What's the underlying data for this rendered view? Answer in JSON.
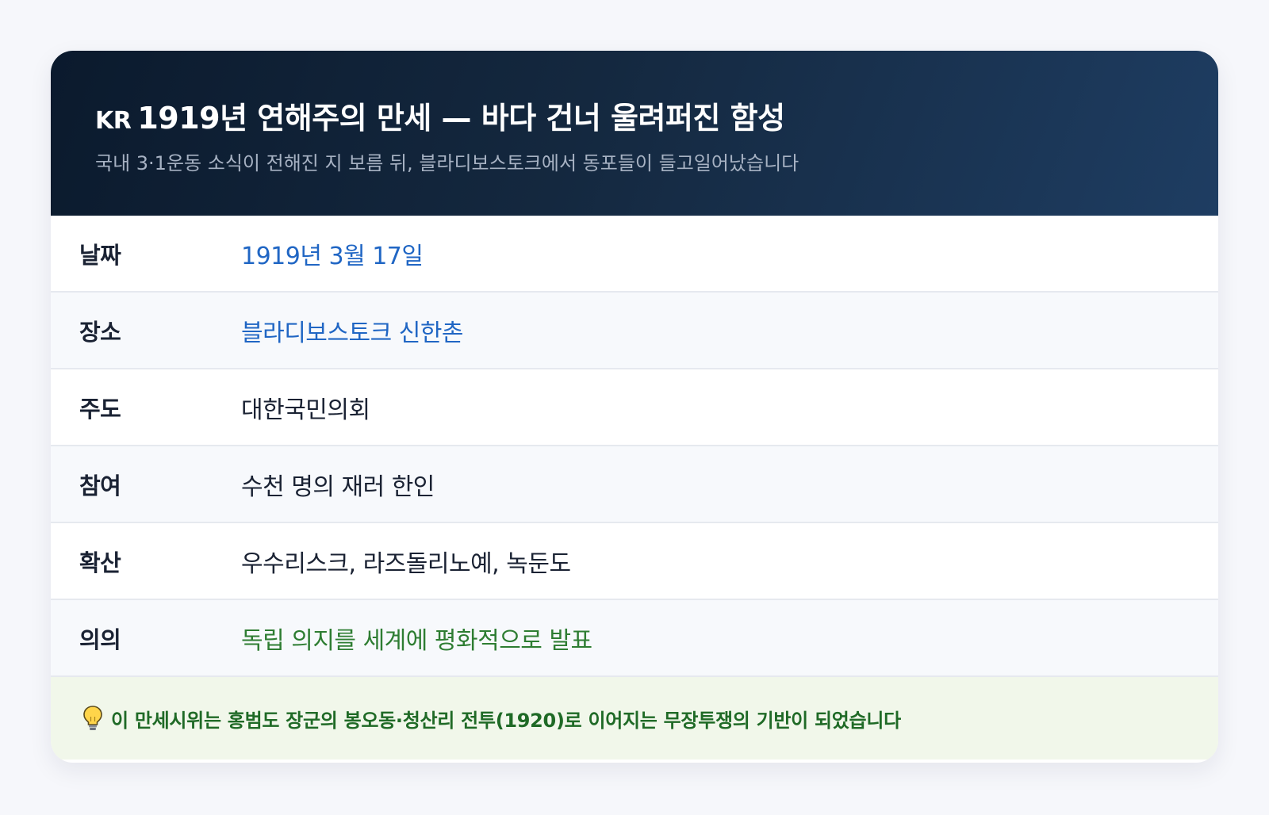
{
  "header": {
    "flag": "KR",
    "title": "1919년 연해주의 만세 — 바다 건너 울려퍼진 함성",
    "subtitle": "국내 3·1운동 소식이 전해진 지 보름 뒤, 블라디보스토크에서 동포들이 들고일어났습니다"
  },
  "rows": [
    {
      "label": "날짜",
      "value": "1919년 3월 17일",
      "color": "#2066c4"
    },
    {
      "label": "장소",
      "value": "블라디보스토크 신한촌",
      "color": "#2066c4"
    },
    {
      "label": "주도",
      "value": "대한국민의회",
      "color": "#1a2233"
    },
    {
      "label": "참여",
      "value": "수천 명의 재러 한인",
      "color": "#1a2233"
    },
    {
      "label": "확산",
      "value": "우수리스크, 라즈돌리노예, 녹둔도",
      "color": "#1a2233"
    },
    {
      "label": "의의",
      "value": "독립 의지를 세계에 평화적으로 발표",
      "color": "#2e7d32"
    }
  ],
  "note": {
    "icon": "lightbulb-icon",
    "text": "이 만세시위는 홍범도 장군의 봉오동·청산리 전투(1920)로 이어지는 무장투쟁의 기반이 되었습니다"
  }
}
